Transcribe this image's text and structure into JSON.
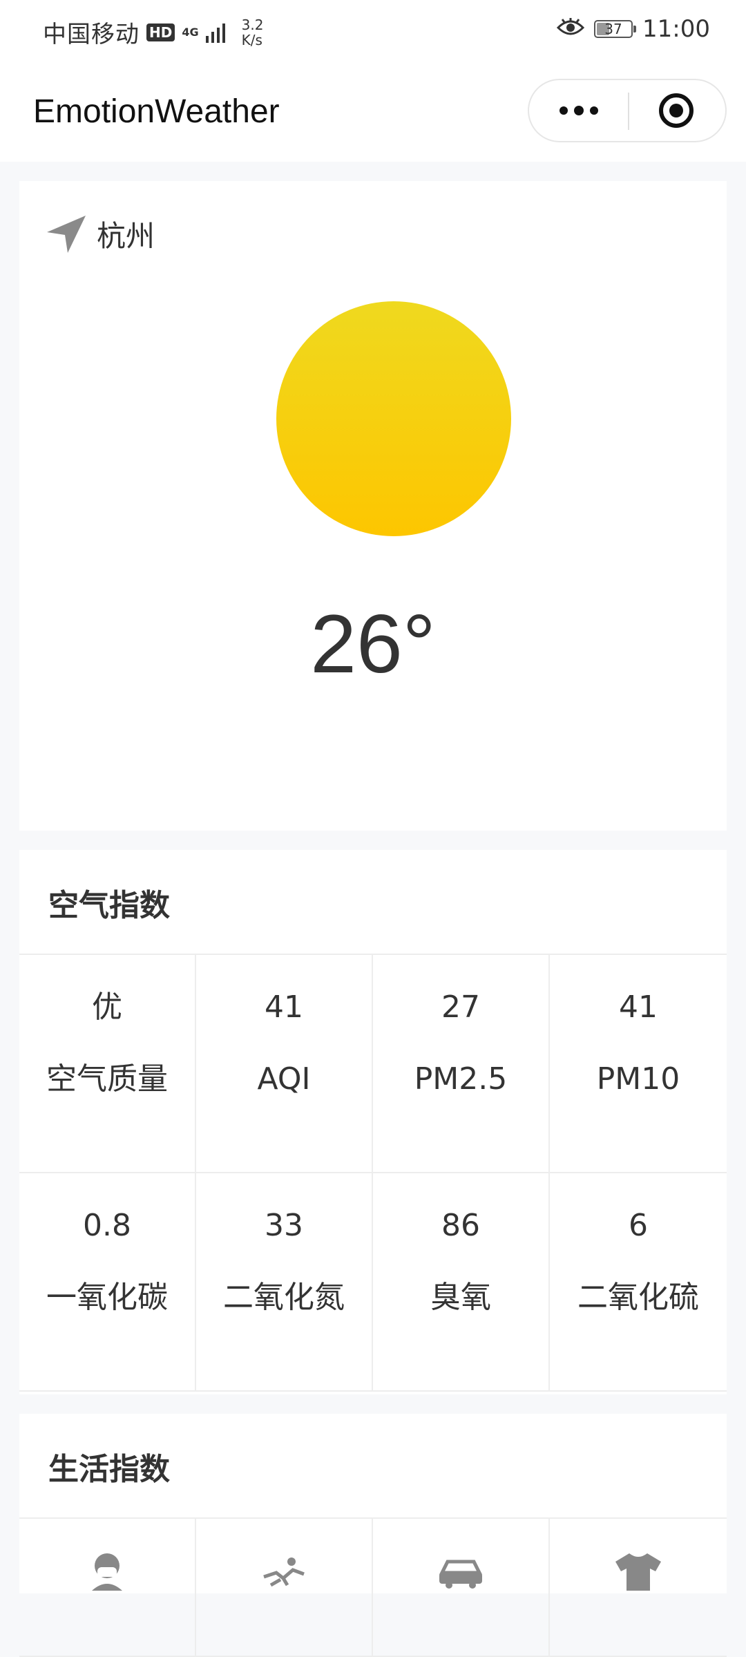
{
  "status_bar": {
    "carrier": "中国移动",
    "hd": "HD",
    "network": "4G",
    "speed_value": "3.2",
    "speed_unit": "K/s",
    "battery": "37",
    "time": "11:00"
  },
  "nav": {
    "title": "EmotionWeather"
  },
  "weather": {
    "location": "杭州",
    "temperature": "26°",
    "sun_colors": [
      "#efd91f",
      "#fdc600"
    ]
  },
  "air": {
    "title": "空气指数",
    "items": [
      {
        "value": "优",
        "label": "空气质量"
      },
      {
        "value": "41",
        "label": "AQI"
      },
      {
        "value": "27",
        "label": "PM2.5"
      },
      {
        "value": "41",
        "label": "PM10"
      },
      {
        "value": "0.8",
        "label": "一氧化碳"
      },
      {
        "value": "33",
        "label": "二氧化氮"
      },
      {
        "value": "86",
        "label": "臭氧"
      },
      {
        "value": "6",
        "label": "二氧化硫"
      }
    ]
  },
  "life": {
    "title": "生活指数",
    "items": [
      {
        "icon": "mask-person-icon"
      },
      {
        "icon": "exercise-icon"
      },
      {
        "icon": "car-icon"
      },
      {
        "icon": "tshirt-icon"
      }
    ]
  }
}
